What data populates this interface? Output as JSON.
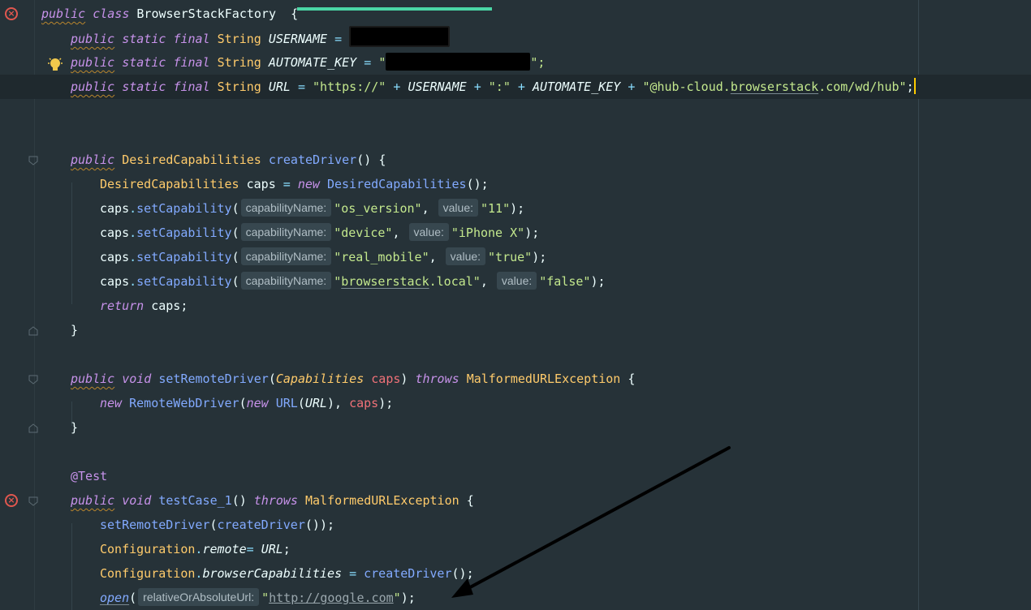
{
  "editor": {
    "icons": {
      "error": "error-circle-icon",
      "bulb": "lightbulb-icon",
      "fold": "fold-marker-icon"
    },
    "colors": {
      "background": "#263238",
      "keyword": "#C792EA",
      "type": "#FFCB6B",
      "string": "#C3E88D",
      "function": "#82AAFF",
      "error": "#e0574f"
    },
    "tokens": {
      "public": "public",
      "class": "class",
      "static": "static",
      "final": "final",
      "new": "new",
      "void": "void",
      "return": "return",
      "throws": "throws",
      "class_name": "BrowserStackFactory",
      "brace_open": "{",
      "brace_close": "}",
      "string_type": "String",
      "username": "USERNAME",
      "automate_key": "AUTOMATE_KEY",
      "url": "URL",
      "eq": "=",
      "plus": "+",
      "quote": "\"",
      "quote_semi": "\";",
      "semi": ";",
      "str_https": "\"https://\"",
      "str_colon": "\":\"",
      "str_hub_pre": "\"@hub-cloud.",
      "str_hub_link": "browserstack",
      "str_hub_post": ".com/wd/hub\"",
      "desired_caps": "DesiredCapabilities",
      "create_driver": "createDriver",
      "caps": "caps",
      "parens": "()",
      "paren_open": "(",
      "paren_close": ")",
      "comma": ",",
      "dot": ".",
      "set_capability": "setCapability",
      "hint_cap_name": "capabilityName:",
      "hint_value": "value:",
      "str_os_version": "\"os_version\"",
      "str_11": "\"11\"",
      "str_device": "\"device\"",
      "str_iphone": "\"iPhone X\"",
      "str_real_mobile": "\"real_mobile\"",
      "str_true": "\"true\"",
      "str_bs_local_q": "\"",
      "str_bs_local_link": "browserstack",
      "str_bs_local_post": ".local\"",
      "str_false": "\"false\"",
      "set_remote_driver": "setRemoteDriver",
      "capabilities": "Capabilities",
      "malformed": "MalformedURLException",
      "remote_web_driver": "RemoteWebDriver",
      "url_class": "URL",
      "annotation": "@Test",
      "test_case": "testCase_1",
      "configuration": "Configuration",
      "remote": "remote",
      "browser_caps": "browserCapabilities",
      "open": "open",
      "hint_rel_url": "relativeOrAbsoluteUrl:",
      "str_google": "http://google.com",
      "close_semi": ");"
    }
  }
}
